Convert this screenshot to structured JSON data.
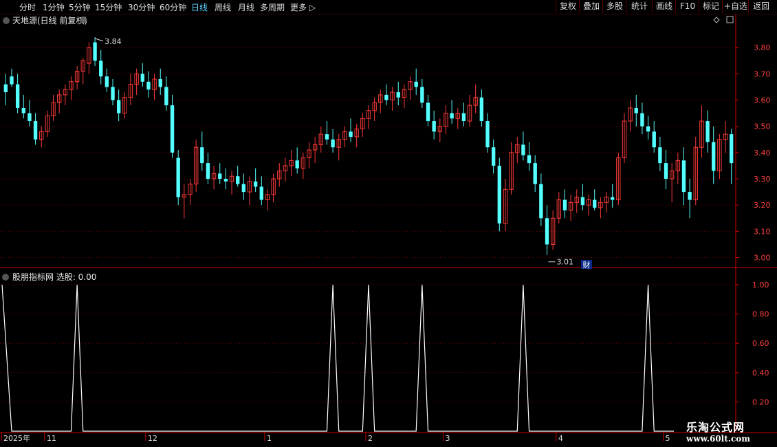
{
  "toolbar": {
    "timeframes": [
      {
        "label": "分时",
        "active": false
      },
      {
        "label": "1分钟",
        "active": false
      },
      {
        "label": "5分钟",
        "active": false
      },
      {
        "label": "15分钟",
        "active": false
      },
      {
        "label": "30分钟",
        "active": false
      },
      {
        "label": "60分钟",
        "active": false
      },
      {
        "label": "日线",
        "active": true
      },
      {
        "label": "周线",
        "active": false
      },
      {
        "label": "月线",
        "active": false
      },
      {
        "label": "多周期",
        "active": false
      },
      {
        "label": "更多 ▷",
        "active": false
      }
    ],
    "right_buttons": [
      "复权",
      "叠加",
      "多股",
      "统计",
      "画线",
      "F10",
      "标记",
      "+自选",
      "返回"
    ]
  },
  "main_panel": {
    "title": "天地源(日线 前复权)",
    "high_label": "3.84",
    "low_label": "3.01",
    "fin_badge": "财",
    "y_ticks": [
      "3.80",
      "3.70",
      "3.60",
      "3.50",
      "3.40",
      "3.30",
      "3.20",
      "3.10",
      "3.00"
    ],
    "y_min": 2.97,
    "y_max": 3.9
  },
  "indicator_panel": {
    "title": "股朋指标网 选股: 0.00",
    "y_ticks": [
      "1.00",
      "0.80",
      "0.60",
      "0.40",
      "0.20"
    ],
    "signal_bars": [
      0,
      12,
      55,
      61,
      70,
      87,
      108
    ]
  },
  "date_axis": [
    {
      "label": "2025年",
      "bar": 0
    },
    {
      "label": "11",
      "bar": 7
    },
    {
      "label": "12",
      "bar": 24
    },
    {
      "label": "1",
      "bar": 44
    },
    {
      "label": "2",
      "bar": 61
    },
    {
      "label": "3",
      "bar": 74
    },
    {
      "label": "4",
      "bar": 93
    },
    {
      "label": "5",
      "bar": 111
    }
  ],
  "colors": {
    "up": "#ff3a3a",
    "down": "#54ffff",
    "grid": "#7a0000",
    "axis": "#d00000",
    "text": "#d0d0d0",
    "active": "#5fd3ff",
    "signal": "#ffffff"
  },
  "watermark": {
    "line1": "乐淘公式网",
    "line2": "www.60lt.com"
  }
}
